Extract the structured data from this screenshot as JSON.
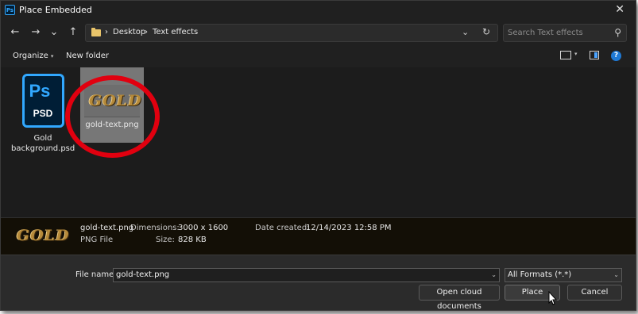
{
  "window": {
    "title": "Place Embedded",
    "app_icon": "photoshop-icon",
    "close_glyph": "✕"
  },
  "nav": {
    "back_glyph": "←",
    "forward_glyph": "→",
    "recent_glyph": "⌄",
    "up_glyph": "↑",
    "breadcrumb": [
      "Desktop",
      "Text effects"
    ],
    "separator": "›",
    "dropdown_glyph": "⌄",
    "refresh_glyph": "↻",
    "search_placeholder": "Search Text effects",
    "search_glyph": "⚲"
  },
  "commands": {
    "organize": "Organize",
    "organize_caret": "▾",
    "new_folder": "New folder",
    "view_caret": "▾",
    "help_glyph": "?"
  },
  "files": [
    {
      "name": "Gold background.psd",
      "icon_ps": "Ps",
      "icon_label": "PSD",
      "type": "psd",
      "selected": false
    },
    {
      "name": "gold-text.png",
      "thumb_text": "GOLD",
      "type": "png",
      "selected": true
    }
  ],
  "details": {
    "preview_text": "GOLD",
    "name": "gold-text.png",
    "type": "PNG File",
    "dimensions_label": "Dimensions:",
    "dimensions": "3000 x 1600",
    "size_label": "Size:",
    "size": "828 KB",
    "date_label": "Date created:",
    "date": "12/14/2023 12:58 PM"
  },
  "footer": {
    "file_name_label": "File name:",
    "file_name_value": "gold-text.png",
    "file_name_caret": "⌄",
    "file_type": "All Formats (*.*)",
    "file_type_caret": "⌄",
    "open_cloud": "Open cloud documents",
    "place": "Place",
    "cancel": "Cancel"
  },
  "colors": {
    "accent": "#31a8ff",
    "annotation": "#e1000f",
    "gold": "#b68a3a"
  }
}
